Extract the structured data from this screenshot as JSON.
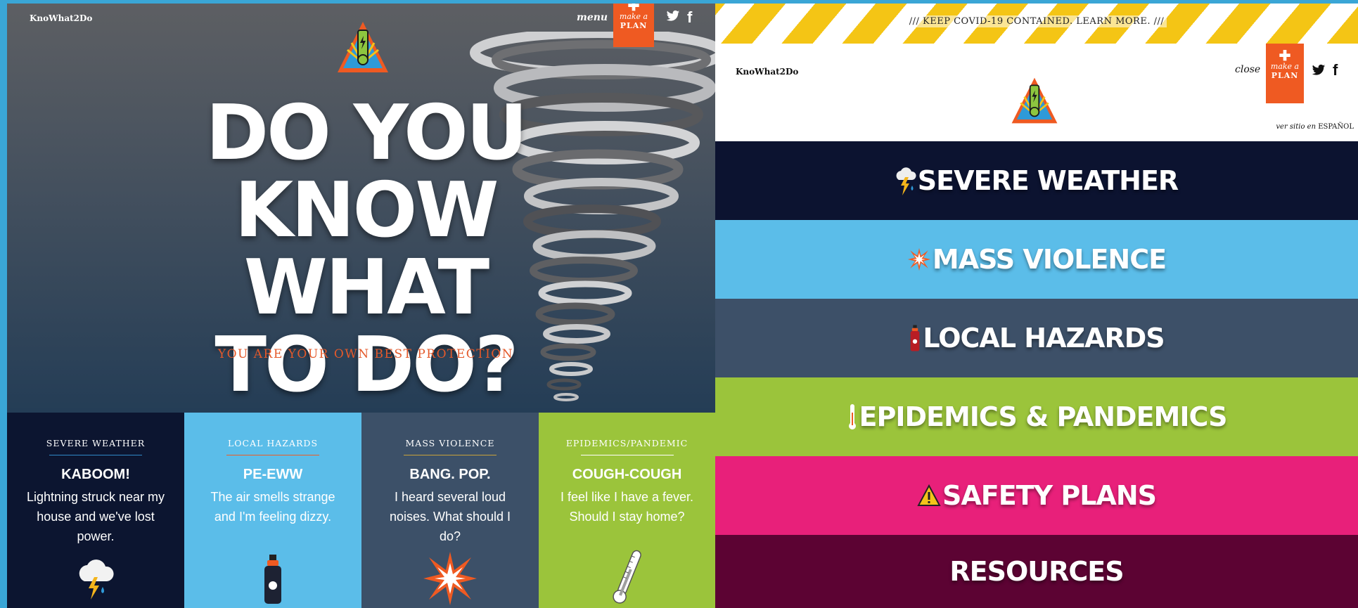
{
  "left": {
    "brand": "KnoWhat2Do",
    "menu_label": "menu",
    "plan_button": {
      "icon": "plus-icon",
      "line1": "make a",
      "line2": "PLAN"
    },
    "social": {
      "twitter_icon": "twitter-icon",
      "facebook_glyph": "f"
    },
    "hero": {
      "title_lines": [
        "DO YOU",
        "KNOW WHAT",
        "TO DO?"
      ],
      "tagline": "YOU ARE YOUR OWN BEST PROTECTION"
    },
    "cards": [
      {
        "category": "SEVERE WEATHER",
        "heading": "KABOOM!",
        "body": "Lightning struck near my house and we've lost power.",
        "icon": "storm-cloud-icon",
        "bg": "#0c1530",
        "rule": "#2f88c8"
      },
      {
        "category": "LOCAL HAZARDS",
        "heading": "PE-EWW",
        "body": "The air smells strange and I'm feeling dizzy.",
        "icon": "spray-can-icon",
        "bg": "#5bbde9",
        "rule": "#ef5a22"
      },
      {
        "category": "MASS VIOLENCE",
        "heading": "BANG. POP.",
        "body": "I heard several loud noises. What should I do?",
        "icon": "explosion-icon",
        "bg": "#3c5068",
        "rule": "#c9a33a"
      },
      {
        "category": "EPIDEMICS/PANDEMIC",
        "heading": "COUGH-COUGH",
        "body": "I feel like I have a fever. Should I stay home?",
        "icon": "thermometer-icon",
        "bg": "#9bc43b",
        "rule": "#ffffff"
      }
    ]
  },
  "right": {
    "banner": "/// KEEP COVID-19  CONTAINED. LEARN MORE. ///",
    "brand": "KnoWhat2Do",
    "close_label": "close",
    "plan_button": {
      "icon": "plus-icon",
      "line1": "make a",
      "line2": "PLAN"
    },
    "social": {
      "twitter_icon": "twitter-icon",
      "facebook_glyph": "f"
    },
    "language": {
      "prefix": "ver sitio en",
      "label": "ESPAÑOL"
    },
    "menu_bands": [
      {
        "label": "SEVERE WEATHER",
        "icon": "storm-cloud-icon",
        "bg": "#0c1330"
      },
      {
        "label": "MASS VIOLENCE",
        "icon": "explosion-icon",
        "bg": "#5bbde9"
      },
      {
        "label": "LOCAL HAZARDS",
        "icon": "spray-can-icon",
        "bg": "#3d5068"
      },
      {
        "label": "EPIDEMICS & PANDEMICS",
        "icon": "thermometer-icon",
        "bg": "#9bc43b"
      },
      {
        "label": "SAFETY PLANS",
        "icon": "warning-icon",
        "bg": "#e8207a"
      },
      {
        "label": "RESOURCES",
        "icon": "",
        "bg": "#5c0333"
      }
    ]
  },
  "colors": {
    "accent_orange": "#ef5a22",
    "stripe_yellow": "#f4c515"
  }
}
